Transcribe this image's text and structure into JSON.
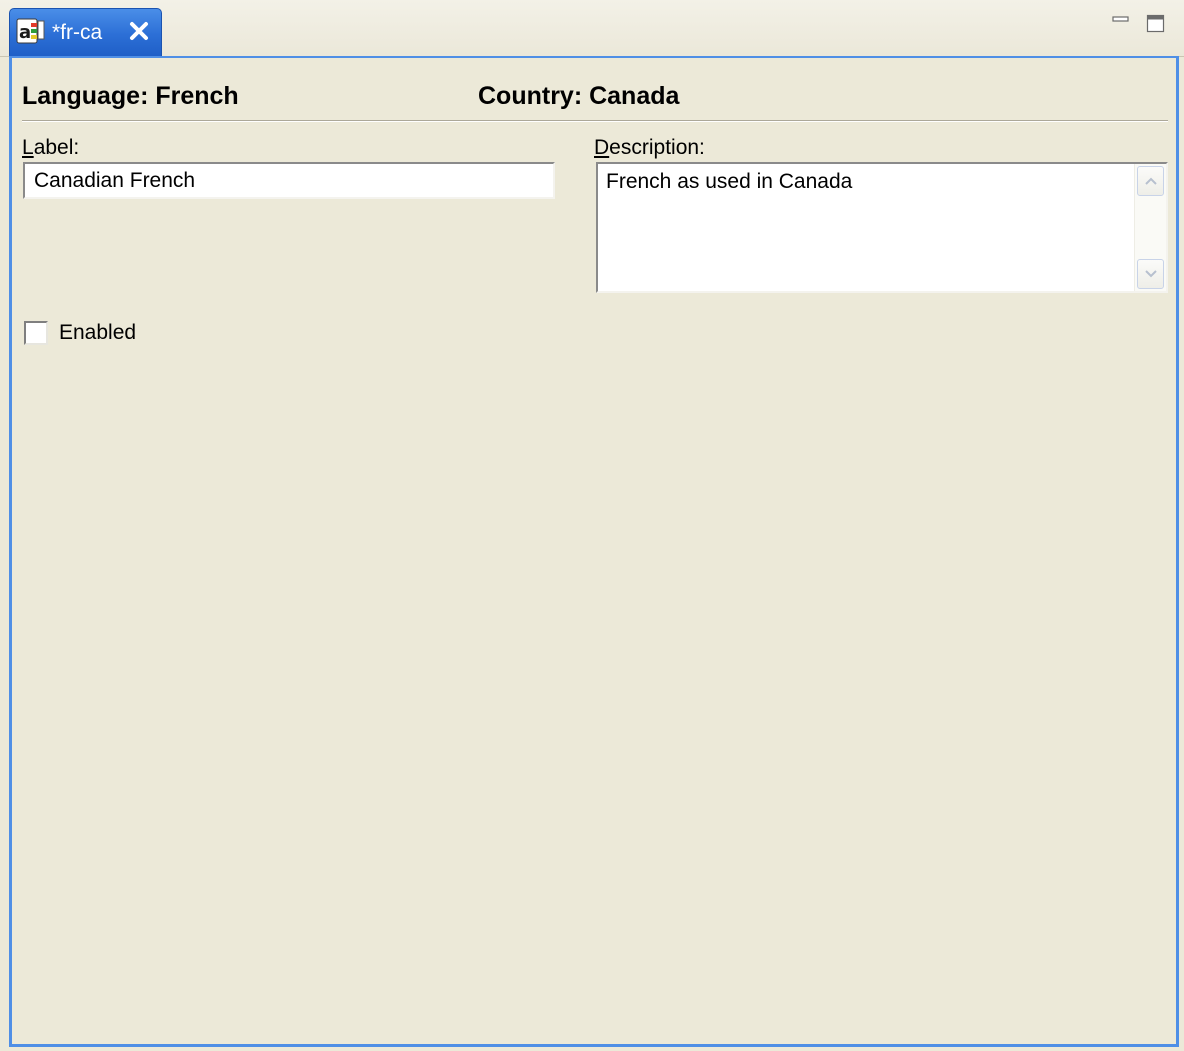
{
  "tab": {
    "title": "*fr-ca",
    "icon": "locale-editor-icon",
    "close_icon": "close-icon"
  },
  "view_controls": {
    "minimize_icon": "minimize-icon",
    "maximize_icon": "maximize-icon"
  },
  "header": {
    "language": "Language: French",
    "country": "Country: Canada"
  },
  "label_field": {
    "caption_mnemonic": "L",
    "caption_rest": "abel:",
    "value": "Canadian French"
  },
  "description_field": {
    "caption_mnemonic": "D",
    "caption_rest": "escription:",
    "value": "French as used in Canada"
  },
  "enabled": {
    "label": "Enabled",
    "checked": false
  },
  "colors": {
    "background": "#ece9d8",
    "active_tab": "#2c6fd6",
    "focus_border": "#4f8fe6"
  }
}
